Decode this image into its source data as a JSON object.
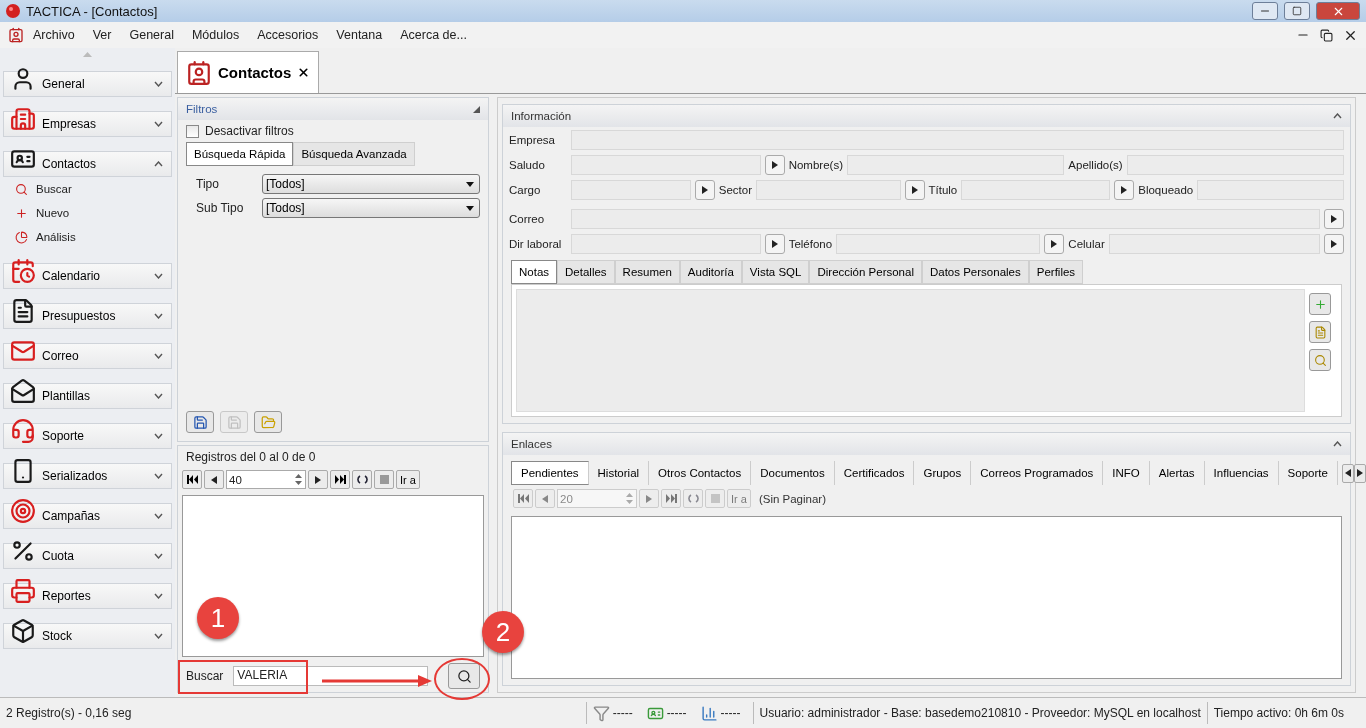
{
  "window": {
    "title": "TACTICA - [Contactos]"
  },
  "menu": [
    "Archivo",
    "Ver",
    "General",
    "Módulos",
    "Accesorios",
    "Ventana",
    "Acerca de..."
  ],
  "sidebar": {
    "items": [
      {
        "label": "General",
        "expanded": false
      },
      {
        "label": "Empresas",
        "expanded": false
      },
      {
        "label": "Contactos",
        "expanded": true,
        "children": [
          {
            "label": "Buscar"
          },
          {
            "label": "Nuevo"
          },
          {
            "label": "Análisis"
          }
        ]
      },
      {
        "label": "Calendario",
        "expanded": false
      },
      {
        "label": "Presupuestos",
        "expanded": false
      },
      {
        "label": "Correo",
        "expanded": false
      },
      {
        "label": "Plantillas",
        "expanded": false
      },
      {
        "label": "Soporte",
        "expanded": false
      },
      {
        "label": "Serializados",
        "expanded": false
      },
      {
        "label": "Campañas",
        "expanded": false
      },
      {
        "label": "Cuota",
        "expanded": false
      },
      {
        "label": "Reportes",
        "expanded": false
      },
      {
        "label": "Stock",
        "expanded": false
      }
    ]
  },
  "doc_tabs": [
    {
      "label": "Contactos",
      "selected": true
    }
  ],
  "filters": {
    "title": "Filtros",
    "disable_filters": {
      "label": "Desactivar filtros",
      "checked": false
    },
    "tabs": [
      {
        "label": "Búsqueda Rápida",
        "selected": true
      },
      {
        "label": "Búsqueda Avanzada",
        "selected": false
      }
    ],
    "fields": [
      {
        "label": "Tipo",
        "value": "[Todos]"
      },
      {
        "label": "Sub Tipo",
        "value": "[Todos]"
      }
    ]
  },
  "records": {
    "summary": "Registros del 0 al 0 de 0",
    "pager": {
      "page_size": "40",
      "goto": "Ir a",
      "disabled": false
    }
  },
  "search": {
    "label": "Buscar",
    "value": "VALERIA"
  },
  "annotations": [
    {
      "number": "1"
    },
    {
      "number": "2"
    }
  ],
  "info": {
    "title": "Información",
    "rows": [
      [
        {
          "label": "Empresa",
          "button": false
        }
      ],
      [
        {
          "label": "Saludo",
          "button": true
        },
        {
          "label": "Nombre(s)",
          "button": false
        },
        {
          "label": "Apellido(s)",
          "button": false
        }
      ],
      [
        {
          "label": "Cargo",
          "button": true
        },
        {
          "label": "Sector",
          "button": true
        },
        {
          "label": "Título",
          "button": true
        },
        {
          "label": "Bloqueado",
          "button": false
        }
      ],
      [
        {
          "label": "Correo",
          "button": true
        }
      ],
      [
        {
          "label": "Dir laboral",
          "button": true
        },
        {
          "label": "Teléfono",
          "button": true
        },
        {
          "label": "Celular",
          "button": true
        }
      ]
    ],
    "tabs": [
      {
        "label": "Notas",
        "selected": true
      },
      {
        "label": "Detalles",
        "selected": false
      },
      {
        "label": "Resumen",
        "selected": false
      },
      {
        "label": "Auditoría",
        "selected": false
      },
      {
        "label": "Vista SQL",
        "selected": false
      },
      {
        "label": "Dirección Personal",
        "selected": false
      },
      {
        "label": "Datos Personales",
        "selected": false
      },
      {
        "label": "Perfiles",
        "selected": false
      }
    ]
  },
  "links": {
    "title": "Enlaces",
    "tabs": [
      {
        "label": "Pendientes",
        "selected": true
      },
      {
        "label": "Historial",
        "selected": false
      },
      {
        "label": "Otros Contactos",
        "selected": false
      },
      {
        "label": "Documentos",
        "selected": false
      },
      {
        "label": "Certificados",
        "selected": false
      },
      {
        "label": "Grupos",
        "selected": false
      },
      {
        "label": "Correos Programados",
        "selected": false
      },
      {
        "label": "INFO",
        "selected": false
      },
      {
        "label": "Alertas",
        "selected": false
      },
      {
        "label": "Influencias",
        "selected": false
      },
      {
        "label": "Soporte",
        "selected": false
      }
    ],
    "pager": {
      "page_size": "20",
      "goto": "Ir a",
      "disabled": true
    },
    "note": "(Sin Paginar)"
  },
  "status_bar": {
    "message": "2 Registro(s) - 0,16 seg",
    "counters": [
      "-----",
      "-----",
      "-----"
    ],
    "connection": "Usuario: administrador - Base: basedemo210810 - Proveedor: MySQL en localhost",
    "uptime": "Tiempo activo: 0h 6m 0s"
  }
}
